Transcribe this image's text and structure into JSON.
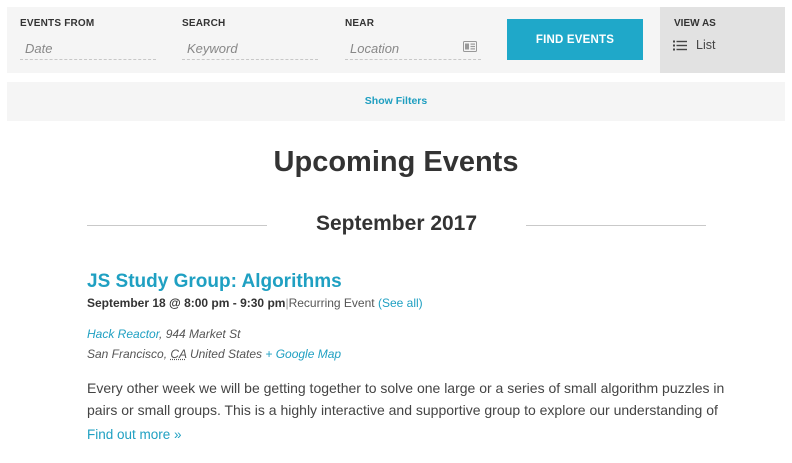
{
  "search_bar": {
    "events_from": {
      "label": "EVENTS FROM",
      "placeholder": "Date"
    },
    "search": {
      "label": "SEARCH",
      "placeholder": "Keyword"
    },
    "near": {
      "label": "NEAR",
      "placeholder": "Location",
      "icon": "map-icon"
    },
    "find_button": "FIND EVENTS",
    "view_as": {
      "label": "VIEW AS",
      "value": "List",
      "icon": "list-icon"
    }
  },
  "filters": {
    "toggle_label": "Show Filters"
  },
  "page_title": "Upcoming Events",
  "month_heading": "September 2017",
  "event": {
    "title": "JS Study Group: Algorithms",
    "datetime": "September 18 @ 8:00 pm - 9:30 pm",
    "separator": "|",
    "recurring": "Recurring Event",
    "see_all": "(See all)",
    "venue_name": "Hack Reactor",
    "venue_street": ", 944 Market St",
    "venue_city": "San Francisco,",
    "venue_state": "CA",
    "venue_country": "United States",
    "map_link": "+ Google Map",
    "description_line1": "Every other week we will be getting together to solve one large or a series of small algorithm puzzles in",
    "description_line2": "pairs or small groups. This is a highly interactive and supportive group to explore our understanding of",
    "find_out_more": "Find out more »"
  },
  "colors": {
    "accent": "#1fa8c9",
    "link": "#1fa0c2",
    "bar_bg": "#f5f5f5",
    "viewas_bg": "#e2e2e2",
    "text": "#333333"
  }
}
